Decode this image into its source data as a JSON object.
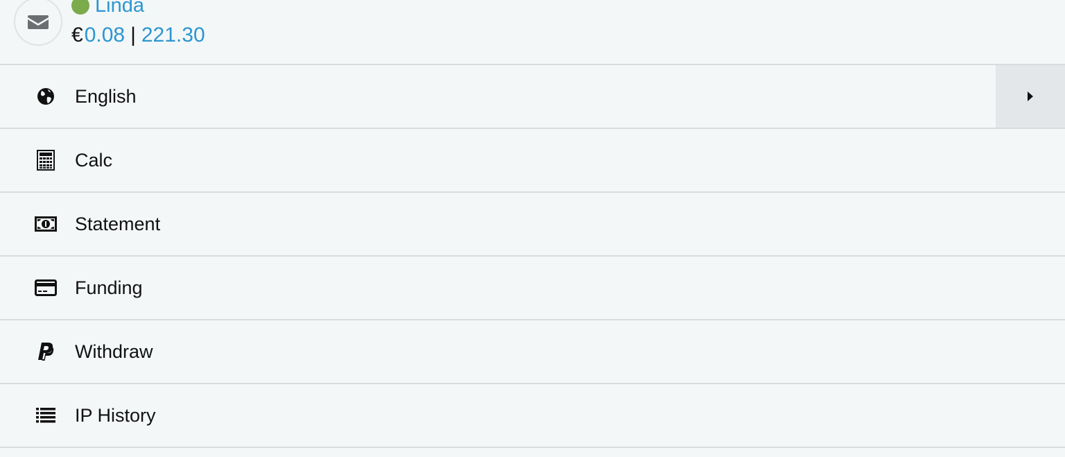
{
  "user": {
    "name": "Linda",
    "status_color": "#7cab4b",
    "currency_symbol": "€",
    "balance_primary": "0.08",
    "separator": "|",
    "balance_secondary": "221.30"
  },
  "menu": [
    {
      "label": "English",
      "icon": "globe-icon",
      "has_submenu": true
    },
    {
      "label": "Calc",
      "icon": "calculator-icon"
    },
    {
      "label": "Statement",
      "icon": "money-bill-icon"
    },
    {
      "label": "Funding",
      "icon": "credit-card-icon"
    },
    {
      "label": "Withdraw",
      "icon": "paypal-icon"
    },
    {
      "label": "IP History",
      "icon": "list-icon"
    }
  ],
  "colors": {
    "link": "#2b96d1",
    "background": "#f4f7f8",
    "divider": "#d8dcde",
    "expand_bg": "#e3e7e9"
  }
}
